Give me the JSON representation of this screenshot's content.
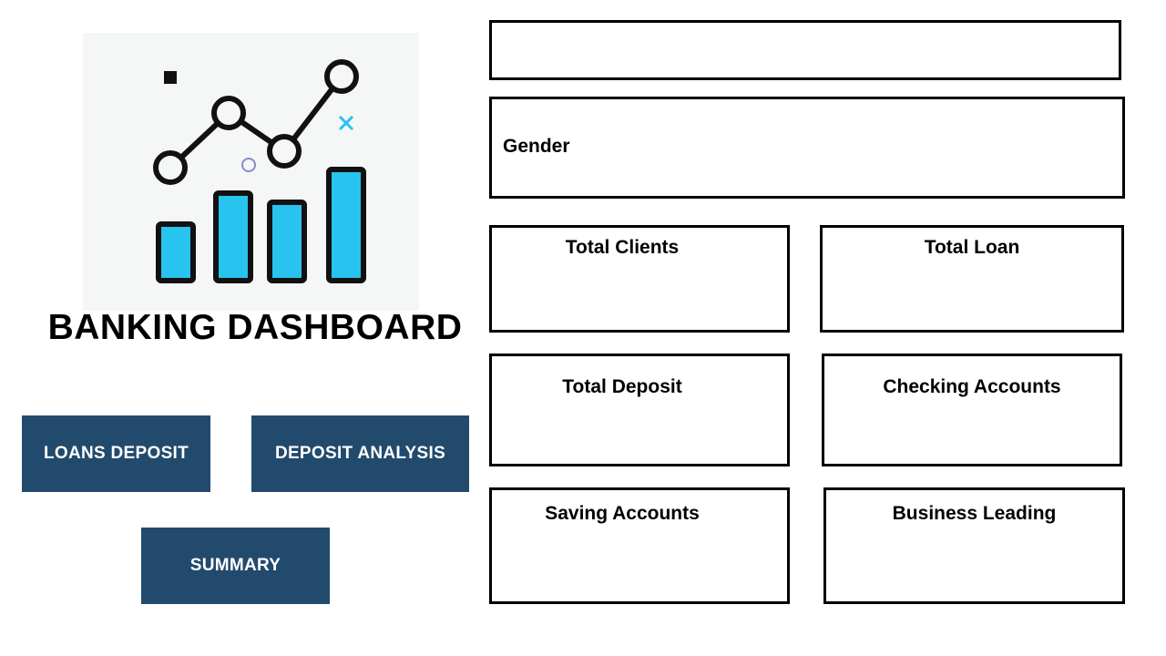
{
  "app": {
    "title": "BANKING DASHBOARD"
  },
  "nav": {
    "loans_deposit": "LOANS DEPOSIT",
    "deposit_analysis": "DEPOSIT ANALYSIS",
    "summary": "SUMMARY"
  },
  "filters": {
    "gender_label": "Gender"
  },
  "kpis": {
    "total_clients": "Total Clients",
    "total_loan": "Total Loan",
    "total_deposit": "Total Deposit",
    "checking_accounts": "Checking Accounts",
    "saving_accounts": "Saving Accounts",
    "business_leading": "Business Leading"
  },
  "colors": {
    "nav_button": "#224a6d",
    "accent": "#29c3f0",
    "border": "#000000"
  },
  "icons": {
    "logo": "chart-growth-icon"
  }
}
